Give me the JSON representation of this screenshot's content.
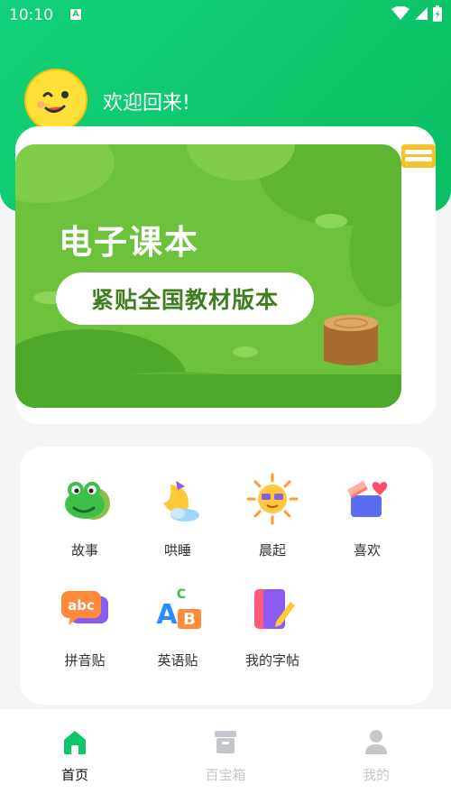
{
  "statusbar": {
    "time": "10:10"
  },
  "header": {
    "welcome": "欢迎回来!"
  },
  "banner": {
    "title": "电子课本",
    "subtitle": "紧贴全国教材版本"
  },
  "grid": [
    {
      "label": "故事",
      "icon": "frog-icon"
    },
    {
      "label": "哄睡",
      "icon": "moon-icon"
    },
    {
      "label": "晨起",
      "icon": "sun-icon"
    },
    {
      "label": "喜欢",
      "icon": "gift-heart-icon"
    },
    {
      "label": "拼音贴",
      "icon": "abc-bubble-icon"
    },
    {
      "label": "英语贴",
      "icon": "abc-blocks-icon"
    },
    {
      "label": "我的字帖",
      "icon": "notebook-pen-icon"
    }
  ],
  "tabs": [
    {
      "label": "首页",
      "icon": "home-icon",
      "active": true
    },
    {
      "label": "百宝箱",
      "icon": "box-icon",
      "active": false
    },
    {
      "label": "我的",
      "icon": "user-icon",
      "active": false
    }
  ],
  "colors": {
    "primary": "#0dc66a",
    "banner": "#6cc23c",
    "text": "#333333",
    "inactive": "#c3c7cc"
  }
}
